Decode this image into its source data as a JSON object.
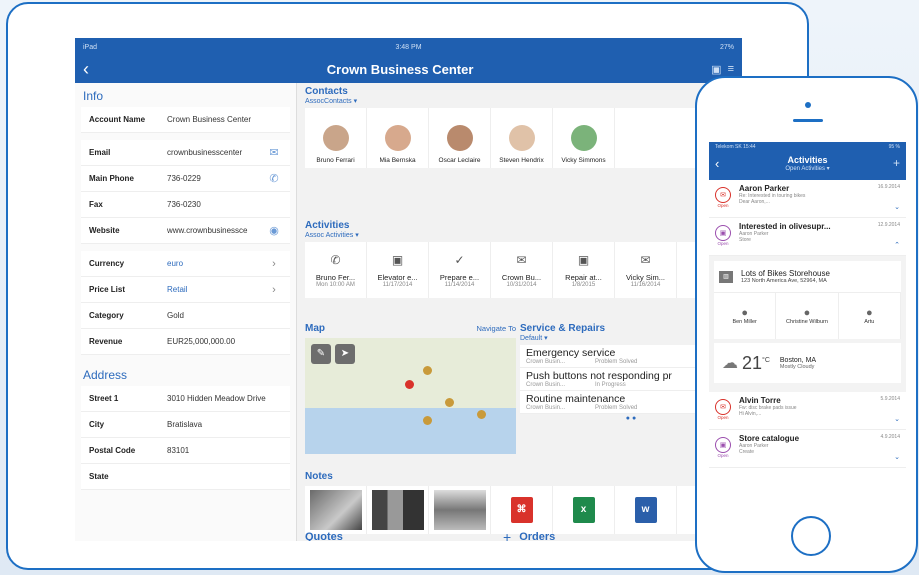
{
  "ipad": {
    "status": {
      "carrier": "iPad",
      "time": "3:48 PM",
      "battery": "27%"
    },
    "nav": {
      "title": "Crown Business Center"
    },
    "info": {
      "title": "Info",
      "groups": [
        [
          {
            "key": "Account Name",
            "value": "Crown Business Center"
          }
        ],
        [
          {
            "key": "Email",
            "value": "crownbusinesscenter",
            "icon": "mail-icon"
          },
          {
            "key": "Main Phone",
            "value": "736-0229",
            "icon": "phone-icon"
          },
          {
            "key": "Fax",
            "value": "736-0230"
          },
          {
            "key": "Website",
            "value": "www.crownbusinessce",
            "icon": "compass-icon"
          }
        ],
        [
          {
            "key": "Currency",
            "value": "euro",
            "link": true,
            "chevron": true
          },
          {
            "key": "Price List",
            "value": "Retail",
            "link": true,
            "chevron": true
          },
          {
            "key": "Category",
            "value": "Gold"
          },
          {
            "key": "Revenue",
            "value": "EUR25,000,000.00"
          }
        ]
      ]
    },
    "address": {
      "title": "Address",
      "rows": [
        {
          "key": "Street 1",
          "value": "3010 Hidden Meadow Drive"
        },
        {
          "key": "City",
          "value": "Bratislava"
        },
        {
          "key": "Postal Code",
          "value": "83101"
        },
        {
          "key": "State",
          "value": ""
        }
      ]
    },
    "contacts": {
      "title": "Contacts",
      "filter": "AssocContacts",
      "people": [
        "Bruno Ferrari",
        "Mia Bernska",
        "Oscar Leclaire",
        "Steven Hendrix",
        "Vicky Simmons"
      ]
    },
    "activities": {
      "title": "Activities",
      "filter": "Assoc Activities",
      "items": [
        {
          "icon": "phone-icon",
          "title": "Bruno Fer...",
          "date": "Mon 10:00 AM"
        },
        {
          "icon": "calendar-icon",
          "title": "Elevator e...",
          "date": "11/17/2014"
        },
        {
          "icon": "checkmark-icon",
          "title": "Prepare e...",
          "date": "11/14/2014"
        },
        {
          "icon": "mail-icon",
          "title": "Crown Bu...",
          "date": "10/31/2014"
        },
        {
          "icon": "calendar-icon",
          "title": "Repair at...",
          "date": "1/8/2015"
        },
        {
          "icon": "mail-icon",
          "title": "Vicky Sim...",
          "date": "11/16/2014"
        }
      ]
    },
    "map": {
      "title": "Map",
      "navigate": "Navigate To"
    },
    "service": {
      "title": "Service & Repairs",
      "filter": "Default",
      "items": [
        {
          "title": "Emergency service",
          "account": "Crown Busin...",
          "status": "Problem Solved"
        },
        {
          "title": "Push buttons not responding pr",
          "account": "Crown Busin...",
          "status": "In Progress"
        },
        {
          "title": "Routine maintenance",
          "account": "Crown Busin...",
          "status": "Problem Solved"
        }
      ]
    },
    "notes": {
      "title": "Notes"
    },
    "quotes": {
      "title": "Quotes",
      "add": "+"
    },
    "orders": {
      "title": "Orders"
    }
  },
  "iphone": {
    "status": {
      "carrier": "Telekom SK",
      "time": "15:44",
      "battery": "95 %"
    },
    "nav": {
      "title": "Activities",
      "subtitle": "Open Activities",
      "add": "+"
    },
    "items": [
      {
        "name": "Aaron Parker",
        "date": "16.9.2014",
        "line1": "Re: Interested in touring bikes",
        "line2": "Dear Aaron,...",
        "state": "Open",
        "type": "mail",
        "chevron": "down"
      },
      {
        "name": "Interested in olivesupr...",
        "date": "12.9.2014",
        "line1": "Aaron Parker",
        "line2": "Store",
        "state": "Open",
        "type": "calendar",
        "chevron": "up"
      }
    ],
    "store": {
      "name": "Lots of Bikes Storehouse",
      "address": "123 North America Ave, 52964, MA"
    },
    "people": [
      "Ben Miller",
      "Christine Wilburn",
      "Artu"
    ],
    "weather": {
      "temp": "21",
      "unit": "°C",
      "city": "Boston, MA",
      "desc": "Mostly Cloudy"
    },
    "items2": [
      {
        "name": "Alvin Torre",
        "date": "5.9.2014",
        "line1": "Fw: disc brake pads issue",
        "line2": "Hi Alvin,...",
        "state": "Open",
        "type": "mail",
        "chevron": "down"
      },
      {
        "name": "Store catalogue",
        "date": "4.9.2014",
        "line1": "Aaron Parker",
        "line2": "Create",
        "state": "Open",
        "type": "calendar",
        "chevron": "down"
      }
    ]
  },
  "colors": {
    "brand": "#1f5fb0",
    "accent": "#2d6bbd",
    "frame": "#1d6fc4",
    "mail": "#d9322b",
    "calendar": "#9b4fae"
  }
}
